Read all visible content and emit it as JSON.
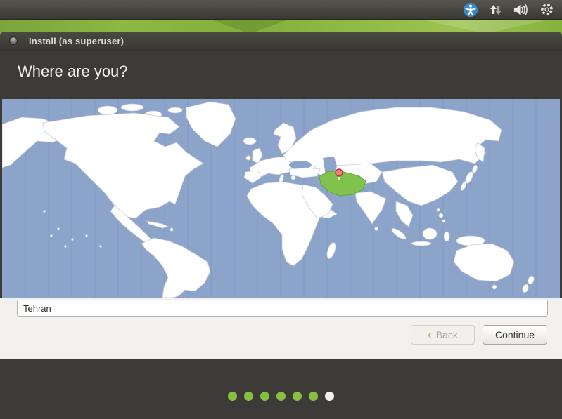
{
  "panel": {
    "icons": [
      {
        "name": "accessibility"
      },
      {
        "name": "network-traffic"
      },
      {
        "name": "volume"
      },
      {
        "name": "session-gear"
      }
    ]
  },
  "window": {
    "titlebar": {
      "title": "Install (as superuser)"
    },
    "heading": "Where are you?"
  },
  "map": {
    "highlighted_country": "Iran",
    "marker_location": "Tehran",
    "colors": {
      "sea": "#8ca4c9",
      "land": "#ffffff",
      "country_border": "#c6cbd4",
      "timezone_line": "#7e96bf",
      "highlight": "#7fc24e",
      "highlight_border": "#5fa32e",
      "marker_fill": "#ee8381",
      "marker_stroke": "#bb2d28"
    }
  },
  "form": {
    "location_input": {
      "value": "Tehran"
    }
  },
  "actions": {
    "back_chevron": "‹",
    "back_label": "Back",
    "continue_label": "Continue"
  },
  "progress": {
    "steps": [
      "done",
      "done",
      "done",
      "done",
      "done",
      "done",
      "current"
    ],
    "done_color": "#86bf44",
    "current_color": "#f1f0ee"
  },
  "theme": {
    "window_bg": "#3c3b37",
    "content_bg": "#f2f1ef",
    "text_light": "#f1efec",
    "text_dark": "#3a3935",
    "wallpaper_green": "#8db841"
  }
}
